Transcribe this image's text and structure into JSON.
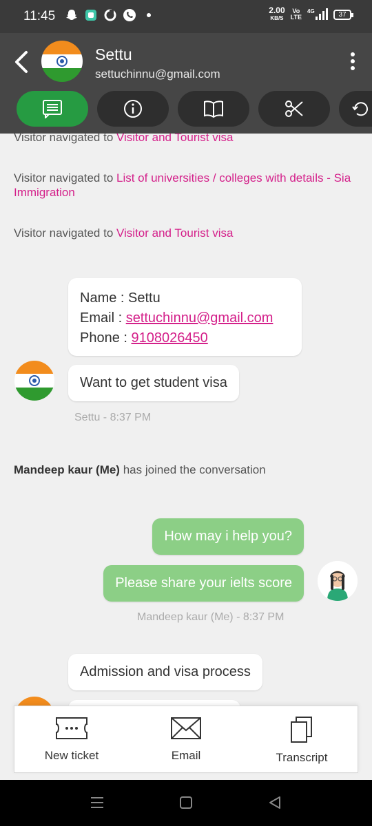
{
  "status_bar": {
    "time": "11:45",
    "net_speed": "2.00",
    "net_unit": "KB/S",
    "volte_top": "Vo",
    "volte_bottom": "LTE",
    "network": "4G",
    "battery": "37",
    "notification_icons": [
      "snapchat-icon",
      "app-icon",
      "data-saver-icon",
      "phone-icon",
      "dot-icon"
    ]
  },
  "header": {
    "contact_name": "Settu",
    "contact_email": "settuchinnu@gmail.com",
    "tabs": [
      {
        "icon": "chat-icon",
        "active": true
      },
      {
        "icon": "info-icon",
        "active": false
      },
      {
        "icon": "book-icon",
        "active": false
      },
      {
        "icon": "scissors-icon",
        "active": false
      },
      {
        "icon": "history-icon",
        "active": false
      }
    ]
  },
  "chat": {
    "events": [
      {
        "prefix": "Visitor navigated to ",
        "link": "Visitor and Tourist visa"
      },
      {
        "prefix": "Visitor navigated to ",
        "link": "List of universities / colleges with details - Sia Immigration"
      },
      {
        "prefix": "Visitor navigated to ",
        "link": "Visitor and Tourist visa"
      }
    ],
    "info_card": {
      "name_label": "Name : ",
      "name_value": "Settu",
      "email_label": "Email : ",
      "email_value": "settuchinnu@gmail.com",
      "phone_label": "Phone : ",
      "phone_value": "9108026450"
    },
    "visitor_message_1": "Want to get student visa",
    "visitor_meta_1": "Settu - 8:37 PM",
    "join_event_name": "Mandeep kaur (Me)",
    "join_event_text": " has joined the conversation",
    "agent_message_1": "How may i help you?",
    "agent_message_2": "Please share your ielts score",
    "agent_meta": "Mandeep kaur (Me) - 8:37 PM",
    "visitor_message_2": "Admission and visa process"
  },
  "actions": {
    "new_ticket": "New ticket",
    "email": "Email",
    "transcript": "Transcript"
  },
  "colors": {
    "accent_green": "#269b42",
    "bubble_green": "#8ccf86",
    "link_pink": "#d4208a",
    "header_bg": "#464646"
  }
}
